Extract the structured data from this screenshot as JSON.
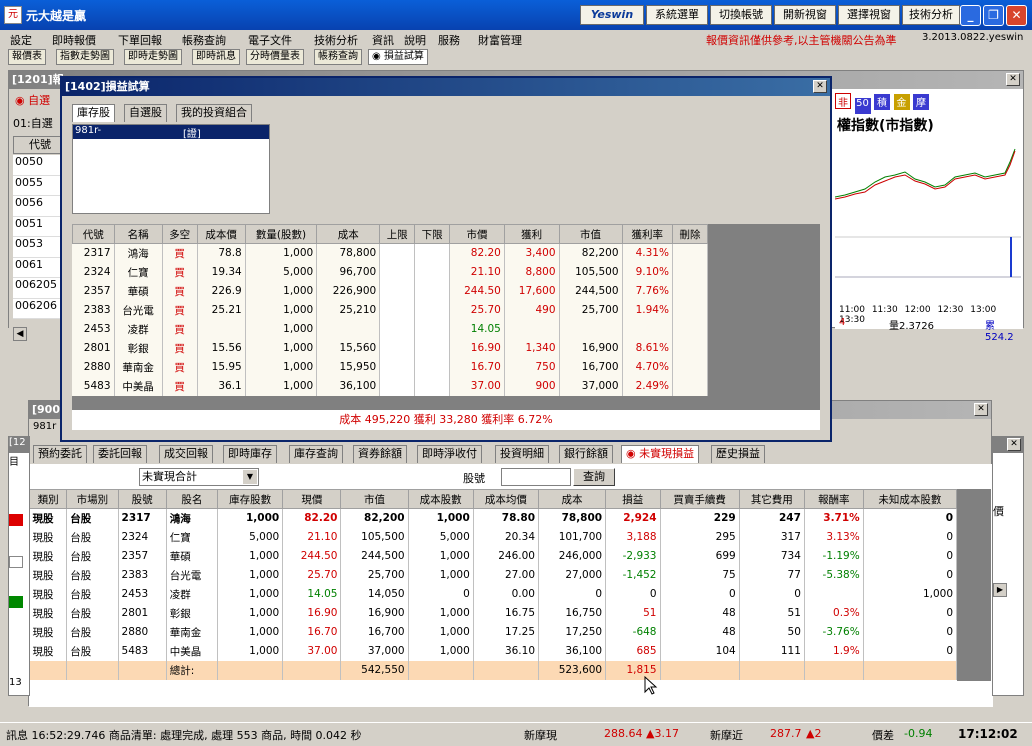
{
  "app": {
    "logo": "元",
    "title": "元大越是贏"
  },
  "topbuttons": [
    "Yeswin",
    "系統選單",
    "切換帳號",
    "開新視窗",
    "選擇視窗",
    "技術分析"
  ],
  "menu": [
    "設定",
    "即時報價",
    "下單回報",
    "帳務查詢",
    "電子文件",
    "技術分析",
    "資訊",
    "說明",
    "服務",
    "財富管理"
  ],
  "notice": "報價資訊僅供參考,以主管機關公告為準",
  "version": "3.2013.0822.yeswin",
  "toolbar": [
    "報價表",
    "指數走勢圖",
    "即時走勢圖",
    "即時訊息",
    "分時價量表",
    "帳務查詢",
    "◉ 損益試算"
  ],
  "bg1201": {
    "title": "[1201]報",
    "radio": "◉ 自選",
    "select": "01:自選",
    "col": "代號",
    "codes": [
      "0050",
      "0055",
      "0056",
      "0051",
      "0053",
      "0061",
      "006205",
      "006206"
    ]
  },
  "chart": {
    "buttons": [
      "非",
      "50",
      "積",
      "金",
      "摩"
    ],
    "title": "權指數(市指數)",
    "times": [
      "11:00",
      "11:30",
      "12:00",
      "12:30",
      "13:00",
      "13:30"
    ],
    "left": "4",
    "vol": "量2.3726",
    "total": "累524.2"
  },
  "calc": {
    "title": "[1402]損益試算",
    "tabs": [
      "庫存股",
      "自選股",
      "我的投資組合"
    ],
    "account": "981r-",
    "account_tag": "[證]",
    "headers": [
      "代號",
      "名稱",
      "多空",
      "成本價",
      "數量(股數)",
      "成本",
      "上限",
      "下限",
      "市價",
      "獲利",
      "市值",
      "獲利率",
      "刪除"
    ],
    "rows": [
      [
        "2317",
        "鴻海",
        "買",
        "78.8",
        "1,000",
        "78,800",
        "",
        "",
        "82.20",
        "3,400",
        "82,200",
        "4.31%",
        ""
      ],
      [
        "2324",
        "仁寶",
        "買",
        "19.34",
        "5,000",
        "96,700",
        "",
        "",
        "21.10",
        "8,800",
        "105,500",
        "9.10%",
        ""
      ],
      [
        "2357",
        "華碩",
        "買",
        "226.9",
        "1,000",
        "226,900",
        "",
        "",
        "244.50",
        "17,600",
        "244,500",
        "7.76%",
        ""
      ],
      [
        "2383",
        "台光電",
        "買",
        "25.21",
        "1,000",
        "25,210",
        "",
        "",
        "25.70",
        "490",
        "25,700",
        "1.94%",
        ""
      ],
      [
        "2453",
        "凌群",
        "買",
        "",
        "1,000",
        "",
        "",
        "",
        "14.05",
        "",
        "",
        "",
        ""
      ],
      [
        "2801",
        "彰銀",
        "買",
        "15.56",
        "1,000",
        "15,560",
        "",
        "",
        "16.90",
        "1,340",
        "16,900",
        "8.61%",
        ""
      ],
      [
        "2880",
        "華南金",
        "買",
        "15.95",
        "1,000",
        "15,950",
        "",
        "",
        "16.70",
        "750",
        "16,700",
        "4.70%",
        ""
      ],
      [
        "5483",
        "中美晶",
        "買",
        "36.1",
        "1,000",
        "36,100",
        "",
        "",
        "37.00",
        "900",
        "37,000",
        "2.49%",
        ""
      ]
    ],
    "summary": "成本 495,220   獲利 33,280   獲利率 6.72%"
  },
  "acct": {
    "title": "[900",
    "account": "981r",
    "tabs": [
      "預約委託",
      "委託回報",
      "成交回報",
      "即時庫存",
      "庫存查詢",
      "資券餘額",
      "即時淨收付",
      "投資明細",
      "銀行餘額",
      "◉ 未實現損益",
      "歷史損益"
    ],
    "select": "未實現合計",
    "stock_label": "股號",
    "query": "查詢",
    "headers": [
      "類別",
      "市場別",
      "股號",
      "股名",
      "庫存股數",
      "現價",
      "市值",
      "成本股數",
      "成本均價",
      "成本",
      "損益",
      "買賣手續費",
      "其它費用",
      "報酬率",
      "未知成本股數"
    ],
    "rows": [
      [
        "現股",
        "台股",
        "2317",
        "鴻海",
        "1,000",
        "82.20",
        "82,200",
        "1,000",
        "78.80",
        "78,800",
        "2,924",
        "229",
        "247",
        "3.71%",
        "0"
      ],
      [
        "現股",
        "台股",
        "2324",
        "仁寶",
        "5,000",
        "21.10",
        "105,500",
        "5,000",
        "20.34",
        "101,700",
        "3,188",
        "295",
        "317",
        "3.13%",
        "0"
      ],
      [
        "現股",
        "台股",
        "2357",
        "華碩",
        "1,000",
        "244.50",
        "244,500",
        "1,000",
        "246.00",
        "246,000",
        "-2,933",
        "699",
        "734",
        "-1.19%",
        "0"
      ],
      [
        "現股",
        "台股",
        "2383",
        "台光電",
        "1,000",
        "25.70",
        "25,700",
        "1,000",
        "27.00",
        "27,000",
        "-1,452",
        "75",
        "77",
        "-5.38%",
        "0"
      ],
      [
        "現股",
        "台股",
        "2453",
        "凌群",
        "1,000",
        "14.05",
        "14,050",
        "0",
        "0.00",
        "0",
        "0",
        "0",
        "0",
        "",
        "1,000"
      ],
      [
        "現股",
        "台股",
        "2801",
        "彰銀",
        "1,000",
        "16.90",
        "16,900",
        "1,000",
        "16.75",
        "16,750",
        "51",
        "48",
        "51",
        "0.3%",
        "0"
      ],
      [
        "現股",
        "台股",
        "2880",
        "華南金",
        "1,000",
        "16.70",
        "16,700",
        "1,000",
        "17.25",
        "17,250",
        "-648",
        "48",
        "50",
        "-3.76%",
        "0"
      ],
      [
        "現股",
        "台股",
        "5483",
        "中美晶",
        "1,000",
        "37.00",
        "37,000",
        "1,000",
        "36.10",
        "36,100",
        "685",
        "104",
        "111",
        "1.9%",
        "0"
      ]
    ],
    "total_label": "總計:",
    "total_mv": "542,550",
    "total_cost": "523,600",
    "total_pl": "1,815"
  },
  "leftstub": {
    "a": "[12",
    "b": "目",
    "c": "13"
  },
  "rightstub": {
    "a": "價"
  },
  "status": {
    "msg": "訊息  16:52:29.746 商品清單: 處理完成, 處理 553 商品, 時間 0.042 秒",
    "label1": "新摩現",
    "val1": "288.64",
    "chg1": "▲3.17",
    "label2": "新摩近",
    "val2": "287.7",
    "chg2": "▲2",
    "label3": "價差",
    "val3": "-0.94",
    "clock": "17:12:02"
  }
}
